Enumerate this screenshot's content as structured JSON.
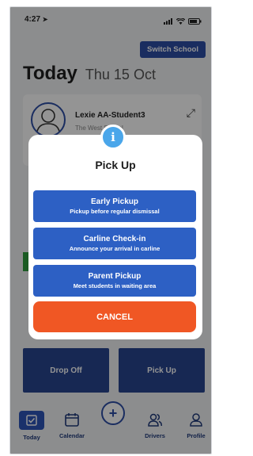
{
  "status_bar": {
    "time": "4:27",
    "location_icon": "location-arrow-icon",
    "signal_icon": "signal-icon",
    "wifi_icon": "wifi-icon",
    "battery_icon": "battery-icon"
  },
  "header": {
    "switch_school_label": "Switch School",
    "title": "Today",
    "date": "Thu 15 Oct"
  },
  "student_card": {
    "name": "Lexie AA-Student3",
    "school": "The West School",
    "avatar_icon": "person-avatar-icon",
    "expand_icon": "expand-arrows-icon"
  },
  "dialog": {
    "icon_label": "i",
    "title": "Pick Up",
    "options": [
      {
        "label": "Early Pickup",
        "sub": "Pickup before regular dismissal"
      },
      {
        "label": "Carline Check-in",
        "sub": "Announce your arrival in carline"
      },
      {
        "label": "Parent Pickup",
        "sub": "Meet students in waiting area"
      }
    ],
    "cancel_label": "CANCEL"
  },
  "actions": {
    "drop_off_label": "Drop Off",
    "pick_up_label": "Pick Up"
  },
  "tabs": [
    {
      "label": "Today",
      "icon": "check-box-icon",
      "active": true
    },
    {
      "label": "Calendar",
      "icon": "calendar-icon"
    },
    {
      "label": "",
      "icon": "plus-circle-icon"
    },
    {
      "label": "Drivers",
      "icon": "drivers-icon"
    },
    {
      "label": "Profile",
      "icon": "person-icon"
    }
  ],
  "colors": {
    "primary": "#2d4ea6",
    "option_blue": "#2d60c4",
    "cancel": "#f05724",
    "info": "#4aa6ea",
    "green": "#2e9e3d"
  }
}
